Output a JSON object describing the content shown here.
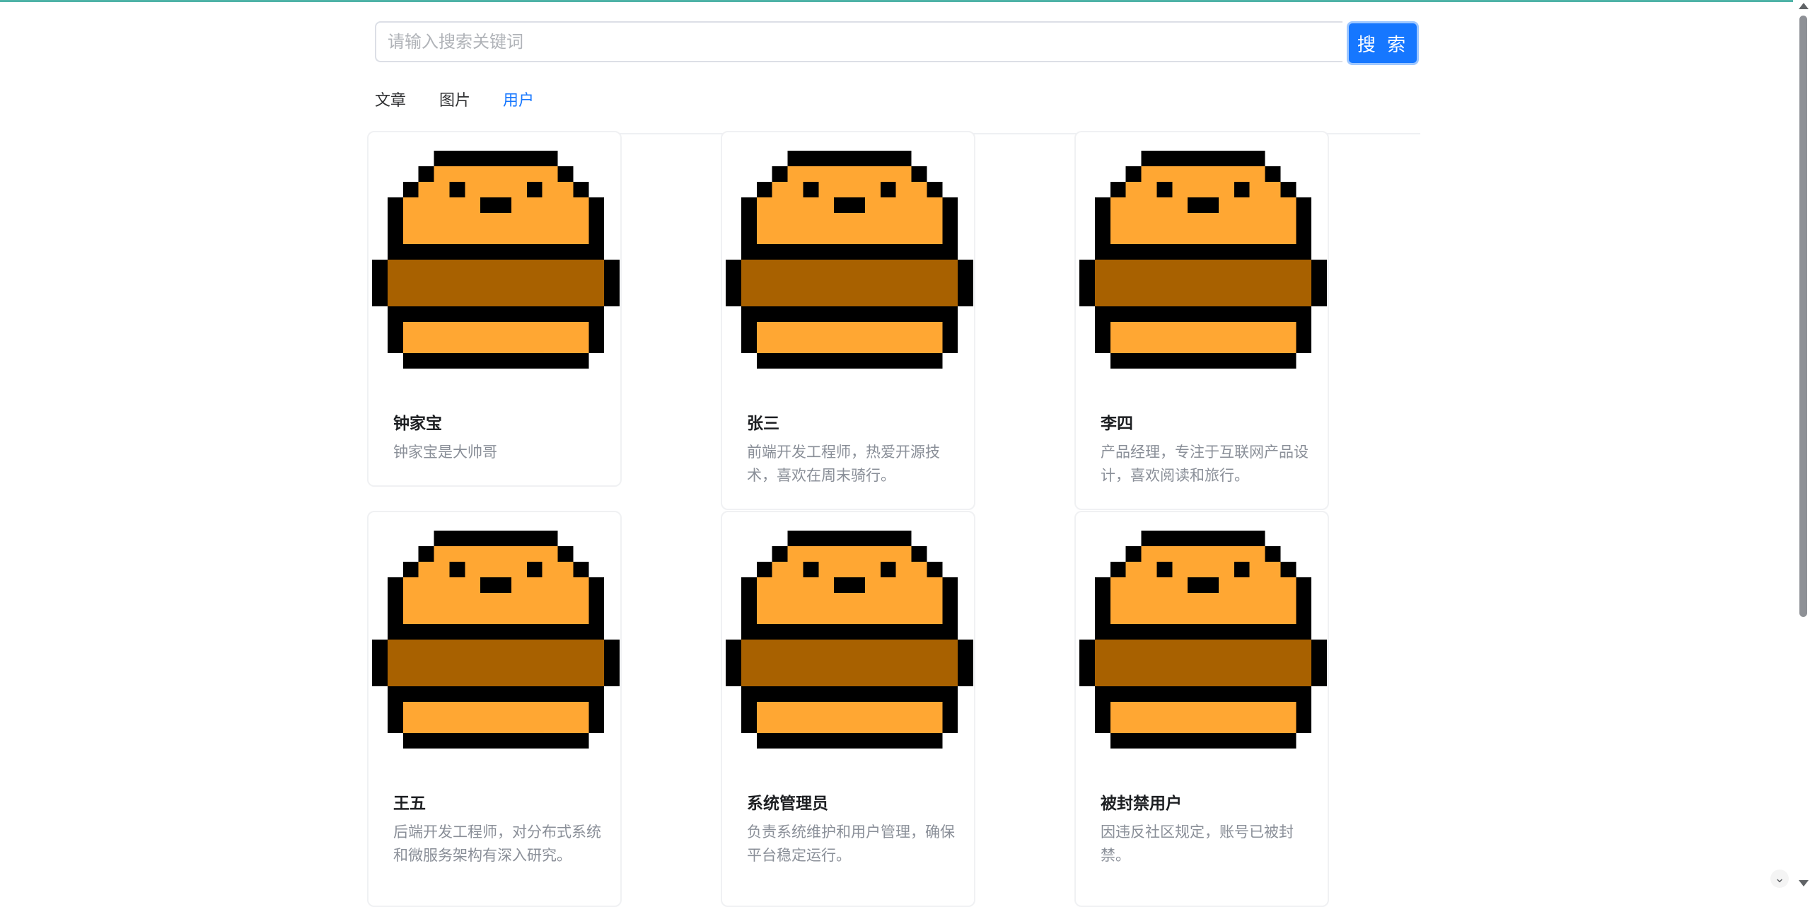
{
  "search": {
    "placeholder": "请输入搜索关键词",
    "value": "",
    "button_label": "搜 索"
  },
  "tabs": [
    {
      "label": "文章",
      "active": false
    },
    {
      "label": "图片",
      "active": false
    },
    {
      "label": "用户",
      "active": true
    }
  ],
  "users": [
    {
      "name": "钟家宝",
      "bio": "钟家宝是大帅哥"
    },
    {
      "name": "张三",
      "bio": "前端开发工程师，热爱开源技术，喜欢在周末骑行。"
    },
    {
      "name": "李四",
      "bio": "产品经理，专注于互联网产品设计，喜欢阅读和旅行。"
    },
    {
      "name": "王五",
      "bio": "后端开发工程师，对分布式系统和微服务架构有深入研究。"
    },
    {
      "name": "系统管理员",
      "bio": "负责系统维护和用户管理，确保平台稳定运行。"
    },
    {
      "name": "被封禁用户",
      "bio": "因违反社区规定，账号已被封禁。"
    }
  ],
  "colors": {
    "accent": "#1677ff",
    "avatar_light": "#ffa733",
    "avatar_dark": "#a86100",
    "avatar_outline": "#000000"
  },
  "icons": {
    "avatar": "pixel-burger-avatar-icon",
    "scroll_up": "arrow-up-icon",
    "scroll_down": "arrow-down-icon",
    "corner": "double-chevron-down-icon"
  }
}
